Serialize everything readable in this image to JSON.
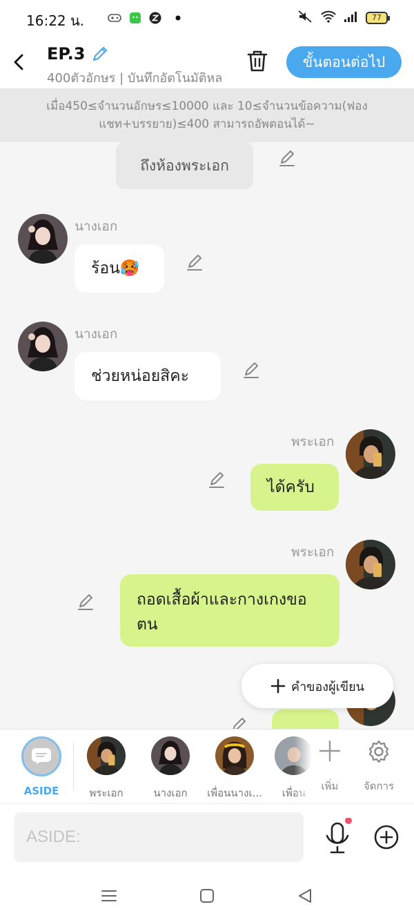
{
  "status_bar": {
    "time": "16:22 น.",
    "battery": "77"
  },
  "header": {
    "episode_title": "EP.3",
    "subtitle": "400ตัวอักษร | บันทึกอัตโนมัติหล",
    "next_button": "ขั้นตอนต่อไป"
  },
  "notice": "เมื่อ450≤จำนวนอักษร≤10000 และ 10≤จำนวนข้อความ(ฟองแชท+บรรยาย)≤400 สามารถอัพตอนได้~",
  "chat": {
    "narration": "ถึงห้องพระเอก",
    "messages": [
      {
        "sender": "นางเอก",
        "text": "ร้อน🥵",
        "side": "left"
      },
      {
        "sender": "นางเอก",
        "text": "ช่วยหน่อยสิคะ",
        "side": "left"
      },
      {
        "sender": "พระเอก",
        "text": "ได้ครับ",
        "side": "right"
      },
      {
        "sender": "พระเอก",
        "text": "ถอดเสื้อผ้าและกางเกงขอตน",
        "side": "right"
      }
    ],
    "author_note_button": "คำของผู้เขียน"
  },
  "characters": [
    {
      "name": "ASIDE",
      "icon": "chat-bubble-icon"
    },
    {
      "name": "พระเอก"
    },
    {
      "name": "นางเอก"
    },
    {
      "name": "เพื่อนนางเ..."
    },
    {
      "name": "เพื่อน"
    }
  ],
  "actions": {
    "add": "เพิ่ม",
    "manage": "จัดการ"
  },
  "input": {
    "placeholder": "ASIDE:"
  },
  "colors": {
    "accent": "#4aa9ee",
    "right_bubble": "#d6f38c",
    "left_bubble": "#ffffff"
  }
}
